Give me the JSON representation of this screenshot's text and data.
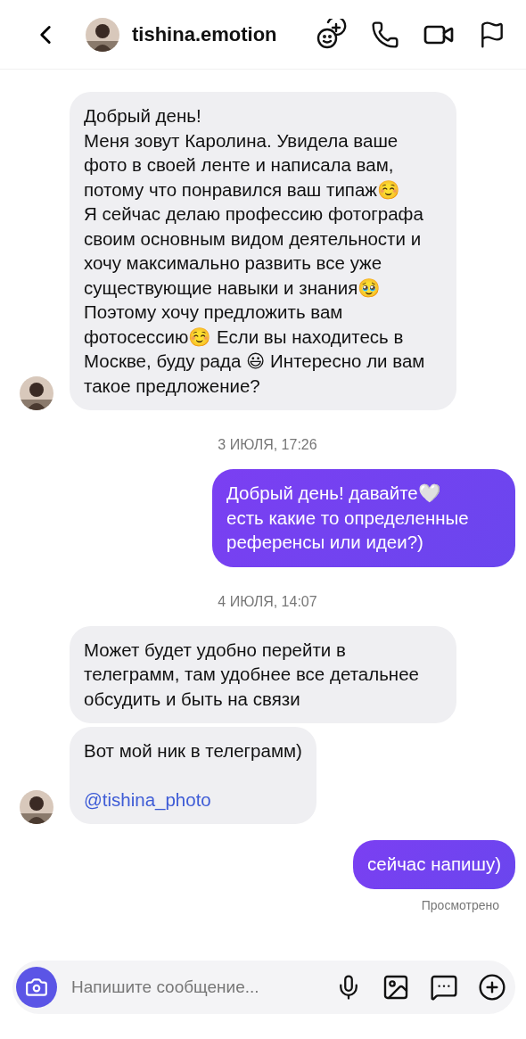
{
  "header": {
    "username": "tishina.emotion"
  },
  "messages": [
    {
      "kind": "received",
      "text": "Добрый день!\nМеня зовут Каролина. Увидела ваше фото в своей ленте и написала вам, потому что понравился ваш типаж☺️\nЯ сейчас делаю профессию фотографа своим основным видом деятельности и хочу максимально развить все уже существующие навыки и знания🥹\nПоэтому хочу предложить вам фотосессию☺️ Если вы находитесь в Москве, буду рада 😃 Интересно ли вам такое предложение?",
      "avatar": true
    },
    {
      "kind": "date",
      "text": "3 ИЮЛЯ, 17:26"
    },
    {
      "kind": "sent",
      "text": "Добрый день! давайте🤍\nесть какие то определенные референсы или идеи?)"
    },
    {
      "kind": "date",
      "text": "4 ИЮЛЯ, 14:07"
    },
    {
      "kind": "received",
      "text": "Может будет удобно перейти в телеграмм, там удобнее все детальнее обсудить и быть на связи",
      "avatar": false
    },
    {
      "kind": "received",
      "text": "Вот мой ник в телеграмм)",
      "link": "@tishina_photo",
      "avatar": true
    },
    {
      "kind": "sent",
      "text": "сейчас напишу)"
    },
    {
      "kind": "status",
      "text": "Просмотрено"
    }
  ],
  "composer": {
    "placeholder": "Напишите сообщение..."
  }
}
